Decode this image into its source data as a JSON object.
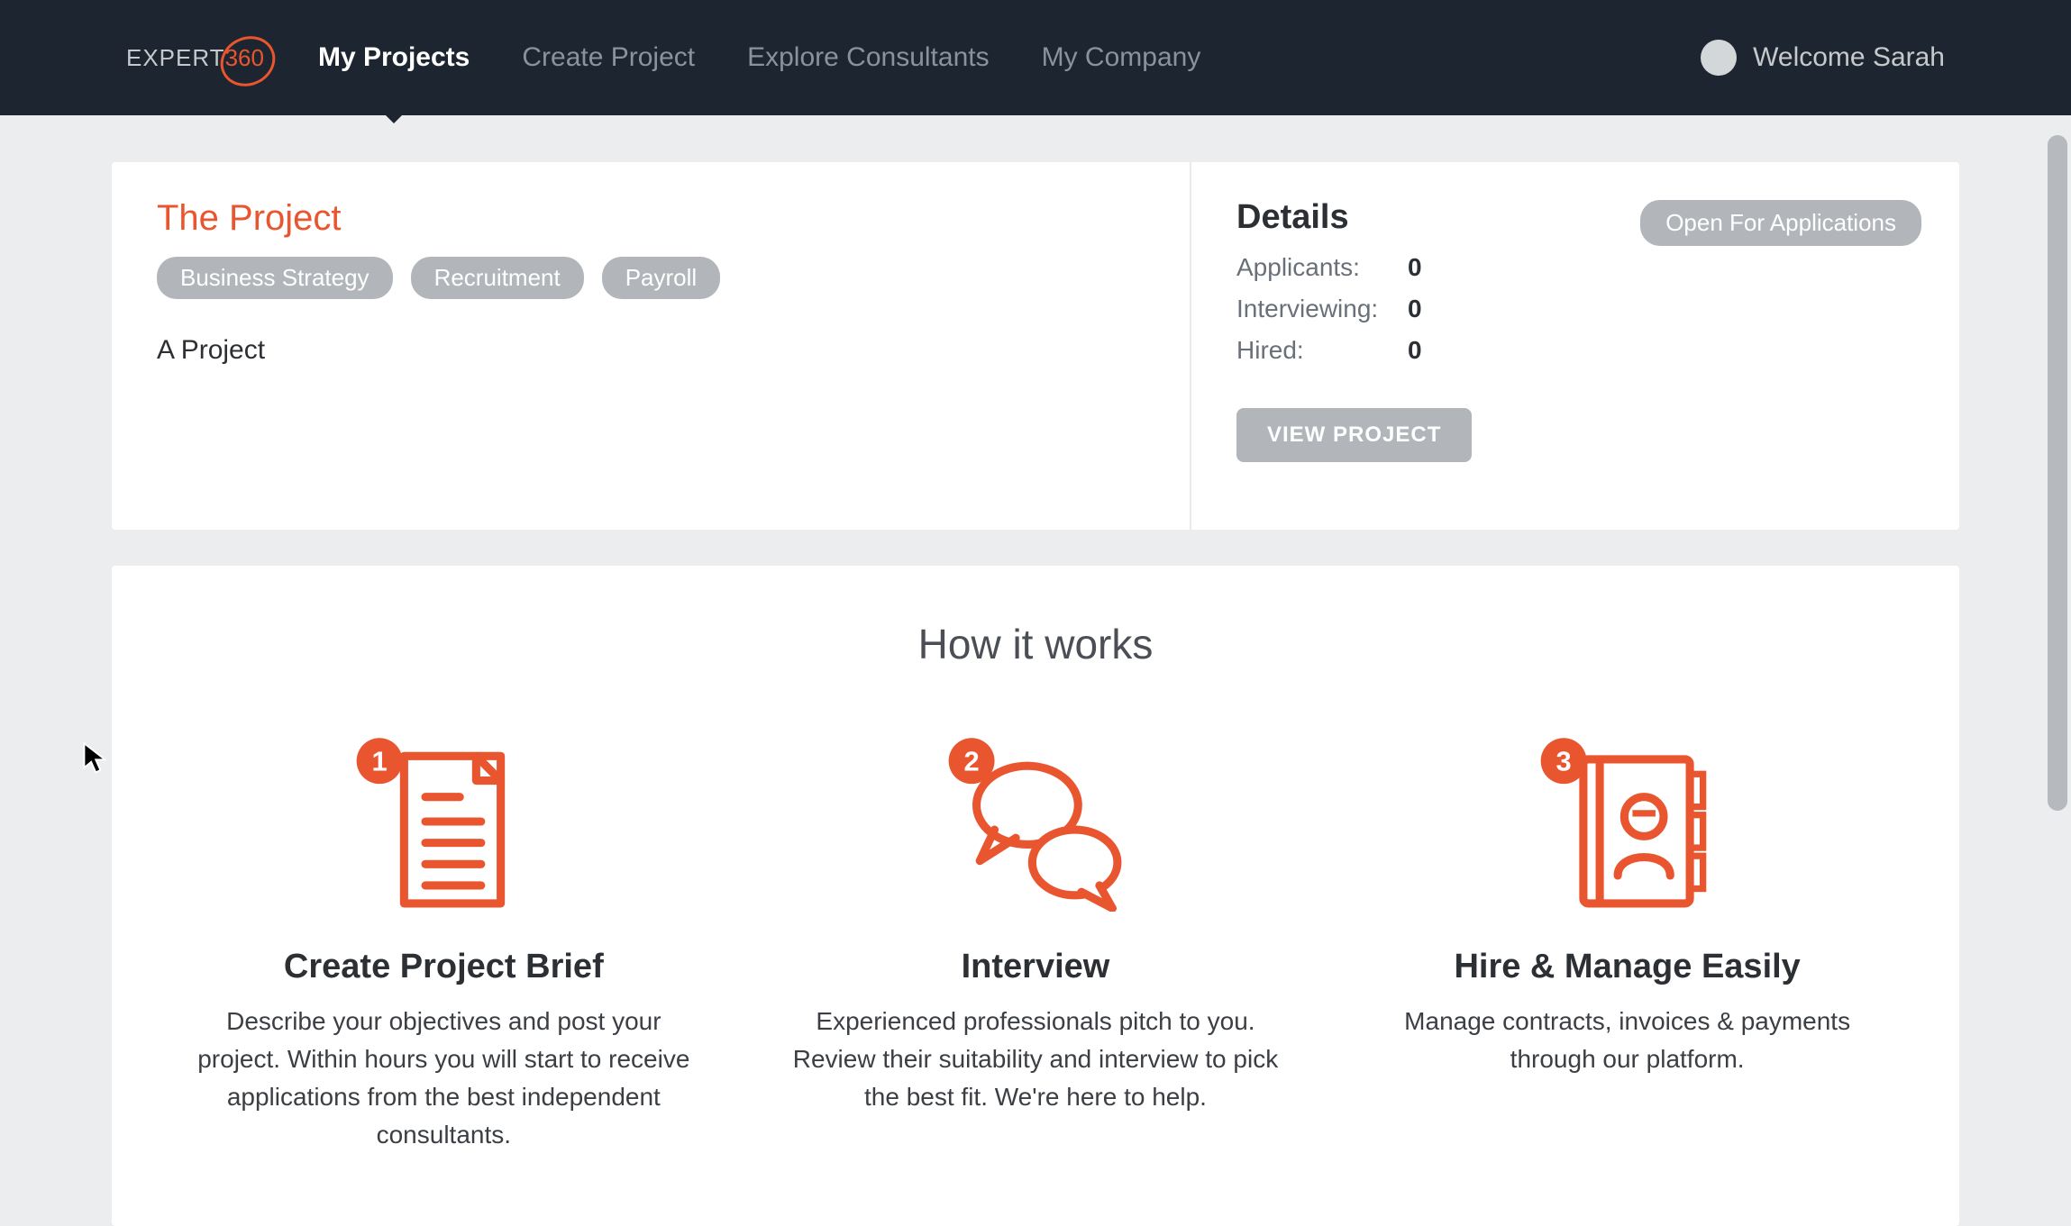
{
  "logo": {
    "text": "EXPERT",
    "accent": "360"
  },
  "nav": {
    "items": [
      {
        "label": "My Projects",
        "active": true
      },
      {
        "label": "Create Project",
        "active": false
      },
      {
        "label": "Explore Consultants",
        "active": false
      },
      {
        "label": "My Company",
        "active": false
      }
    ]
  },
  "user": {
    "welcome": "Welcome Sarah"
  },
  "project": {
    "title": "The Project",
    "tags": [
      "Business Strategy",
      "Recruitment",
      "Payroll"
    ],
    "description": "A Project",
    "details_heading": "Details",
    "status": "Open For Applications",
    "stats": {
      "applicants_label": "Applicants:",
      "applicants_value": "0",
      "interviewing_label": "Interviewing:",
      "interviewing_value": "0",
      "hired_label": "Hired:",
      "hired_value": "0"
    },
    "view_button": "VIEW PROJECT"
  },
  "how": {
    "heading": "How it works",
    "steps": [
      {
        "number": "1",
        "title": "Create Project Brief",
        "desc": "Describe your objectives and post your project. Within hours you will start to receive applications from the best independent consultants."
      },
      {
        "number": "2",
        "title": "Interview",
        "desc": "Experienced professionals pitch to you. Review their suitability and interview to pick the best fit. We're here to help."
      },
      {
        "number": "3",
        "title": "Hire & Manage Easily",
        "desc": "Manage contracts, invoices & payments through our platform."
      }
    ]
  }
}
